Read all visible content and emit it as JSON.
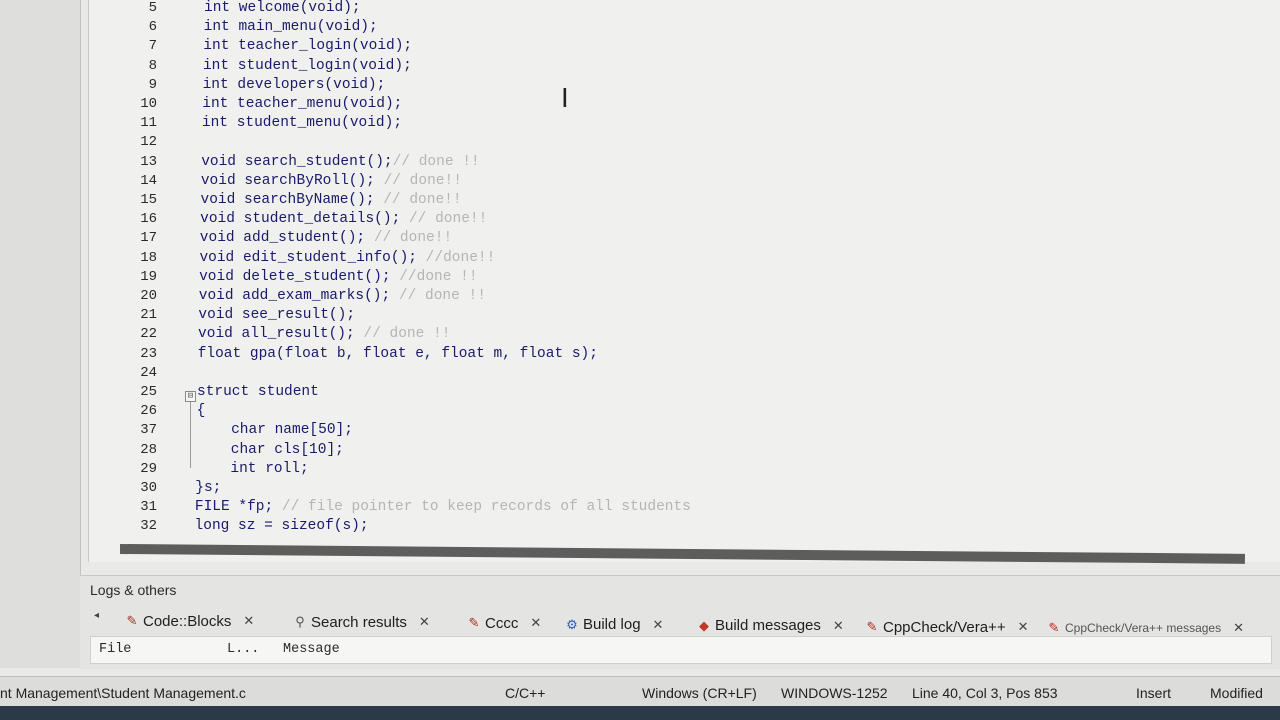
{
  "editor": {
    "line_numbers": [
      "5",
      "6",
      "7",
      "8",
      "9",
      "10",
      "11",
      "12",
      "13",
      "14",
      "15",
      "16",
      "17",
      "18",
      "19",
      "20",
      "21",
      "22",
      "23",
      "24",
      "25",
      "26",
      "37",
      "28",
      "29",
      "30",
      "31",
      "32"
    ],
    "lines": [
      {
        "code": "int welcome(void);",
        "comment": ""
      },
      {
        "code": "int main_menu(void);",
        "comment": ""
      },
      {
        "code": "int teacher_login(void);",
        "comment": ""
      },
      {
        "code": "int student_login(void);",
        "comment": ""
      },
      {
        "code": "int developers(void);",
        "comment": ""
      },
      {
        "code": "int teacher_menu(void);",
        "comment": ""
      },
      {
        "code": "int student_menu(void);",
        "comment": ""
      },
      {
        "code": "",
        "comment": ""
      },
      {
        "code": "void search_student();",
        "comment": "// done !!"
      },
      {
        "code": "void searchByRoll();",
        "comment": " // done!!"
      },
      {
        "code": "void searchByName();",
        "comment": " // done!!"
      },
      {
        "code": "void student_details();",
        "comment": " // done!!"
      },
      {
        "code": "void add_student();",
        "comment": " // done!!"
      },
      {
        "code": "void edit_student_info();",
        "comment": " //done!!"
      },
      {
        "code": "void delete_student();",
        "comment": " //done !!"
      },
      {
        "code": "void add_exam_marks();",
        "comment": " // done !!"
      },
      {
        "code": "void see_result();",
        "comment": ""
      },
      {
        "code": "void all_result();",
        "comment": " // done !!"
      },
      {
        "code": "float gpa(float b, float e, float m, float s);",
        "comment": ""
      },
      {
        "code": "",
        "comment": ""
      },
      {
        "code": "struct student",
        "comment": ""
      },
      {
        "code": "{",
        "comment": ""
      },
      {
        "code": "    char name[50];",
        "comment": ""
      },
      {
        "code": "    char cls[10];",
        "comment": ""
      },
      {
        "code": "    int roll;",
        "comment": ""
      },
      {
        "code": "}s;",
        "comment": ""
      },
      {
        "code": "FILE *fp;",
        "comment": " // file pointer to keep records of all students"
      },
      {
        "code": "long sz = sizeof(s);",
        "comment": ""
      }
    ]
  },
  "logs": {
    "title": "Logs & others",
    "tabs": [
      {
        "label": "Code::Blocks",
        "icon": "pencil-icon"
      },
      {
        "label": "Search results",
        "icon": "magnifier-icon"
      },
      {
        "label": "Cccc",
        "icon": "pencil-icon"
      },
      {
        "label": "Build log",
        "icon": "gear-icon"
      },
      {
        "label": "Build messages",
        "icon": "red-marker-icon"
      },
      {
        "label": "CppCheck/Vera++",
        "icon": "pencil-icon"
      },
      {
        "label": "CppCheck/Vera++ messages",
        "icon": "pencil-icon"
      }
    ],
    "columns": {
      "file": "File",
      "line": "L...",
      "message": "Message"
    }
  },
  "status": {
    "file_path": "nt Management\\Student Management.c",
    "language": "C/C++",
    "line_endings": "Windows (CR+LF)",
    "encoding": "WINDOWS-1252",
    "position": "Line 40, Col 3, Pos 853",
    "mode": "Insert",
    "modified": "Modified"
  },
  "colors": {
    "accent_tab_icon": "#c0392b",
    "build_log_icon": "#2a5db0"
  }
}
